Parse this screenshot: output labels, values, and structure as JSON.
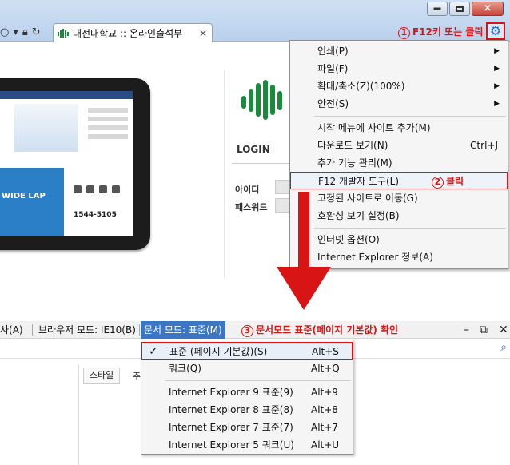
{
  "browser": {
    "tab_title": "대전대학교 :: 온라인출석부",
    "tab_close": "✕",
    "annotation1_num": "1",
    "annotation1_text": "F12키 또는 클릭"
  },
  "page": {
    "login_title": "LOGIN",
    "id_label": "아이디",
    "pw_label": "패스워드",
    "ipad_banner": "WIDE LAP",
    "ipad_phone": "1544-5105",
    "ipad_left_text": "!"
  },
  "tools_menu": {
    "items": [
      {
        "label": "인쇄(P)",
        "submenu": "▶"
      },
      {
        "label": "파일(F)",
        "submenu": "▶"
      },
      {
        "label": "확대/축소(Z)(100%)",
        "submenu": "▶"
      },
      {
        "label": "안전(S)",
        "submenu": "▶"
      },
      {
        "label": "시작 메뉴에 사이트 추가(M)"
      },
      {
        "label": "다운로드 보기(N)",
        "accel": "Ctrl+J"
      },
      {
        "label": "추가 기능 관리(M)"
      },
      {
        "label": "F12 개발자 도구(L)",
        "highlight": true
      },
      {
        "label": "고정된 사이트로 이동(G)"
      },
      {
        "label": "호환성 보기 설정(B)"
      },
      {
        "label": "인터넷 옵션(O)"
      },
      {
        "label": "Internet Explorer 정보(A)"
      }
    ],
    "annotation2_num": "2",
    "annotation2_text": "클릭"
  },
  "devtools": {
    "bar_item1": "사(A)",
    "browser_mode": "브라우저 모드: IE10(B)",
    "document_mode": "문서 모드: 표준(M)",
    "annotation3_num": "3",
    "annotation3_text": "문서모드 표준(페이지 기본값) 확인",
    "style_tab": "스타일",
    "tab2": "추",
    "minimize": "–",
    "restore": "⧉",
    "close": "✕",
    "doc_modes": [
      {
        "label": "표준 (페이지 기본값)(S)",
        "accel": "Alt+S",
        "checked": true
      },
      {
        "label": "쿼크(Q)",
        "accel": "Alt+Q"
      },
      {
        "label": "Internet Explorer 9 표준(9)",
        "accel": "Alt+9"
      },
      {
        "label": "Internet Explorer 8 표준(8)",
        "accel": "Alt+8"
      },
      {
        "label": "Internet Explorer 7 표준(7)",
        "accel": "Alt+7"
      },
      {
        "label": "Internet Explorer 5 쿼크(U)",
        "accel": "Alt+U"
      }
    ]
  },
  "colors": {
    "annotation": "#d91414",
    "selected_menu": "#3a76c2",
    "ie_blue": "#2a6bc3"
  }
}
